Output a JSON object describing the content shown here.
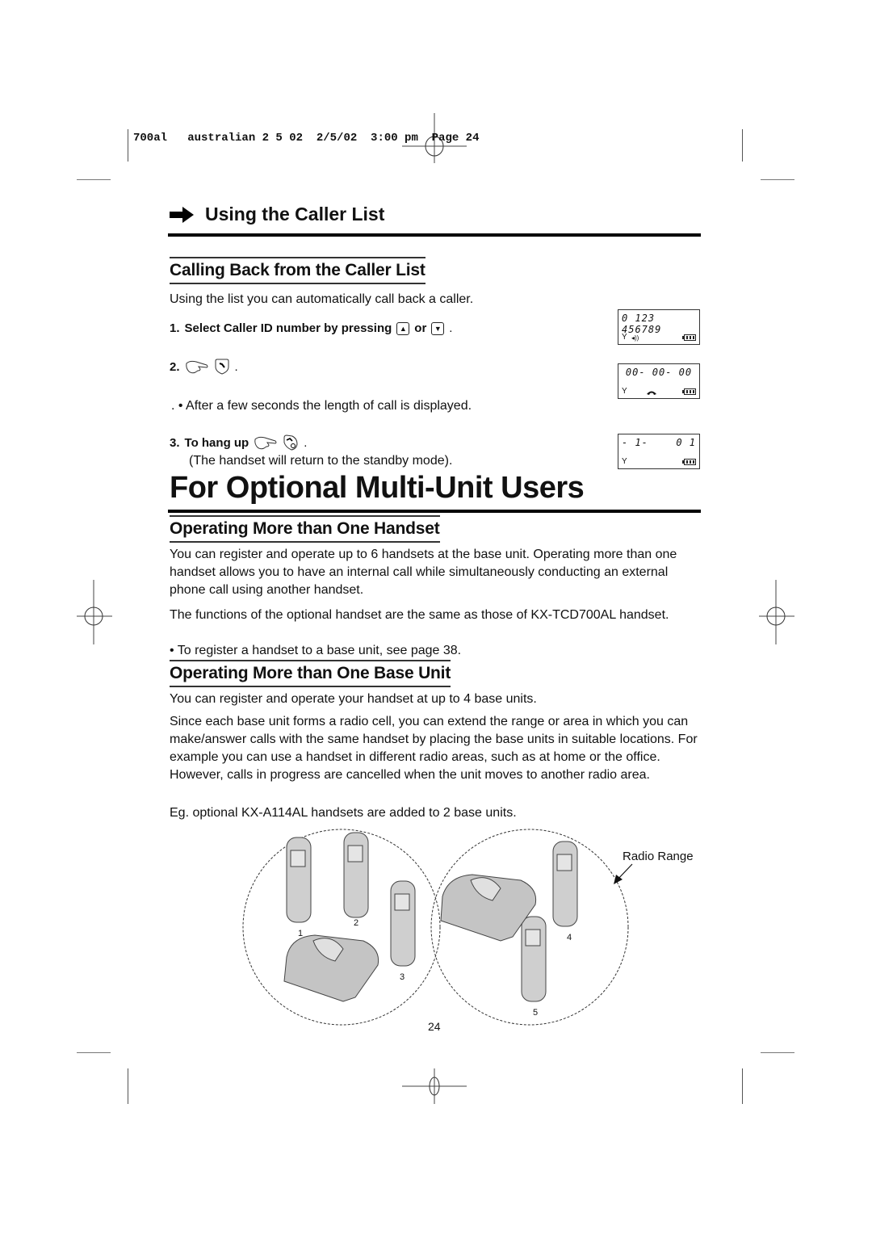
{
  "print_slug": "700al   australian 2 5 02  2/5/02  3:00 pm  Page 24",
  "section": {
    "arrow_icon": "right-arrow-icon",
    "title": "Using the Caller List"
  },
  "calling_back": {
    "heading": "Calling Back from the Caller List",
    "intro": "Using the list you can automatically call back a caller.",
    "steps": [
      {
        "num": "1.",
        "text": "Select Caller ID number by pressing",
        "keys": [
          "up-key",
          "down-key"
        ],
        "joiner": "or"
      },
      {
        "num": "2.",
        "text": "",
        "keys": [
          "press-hand",
          "talk-key"
        ]
      },
      {
        "num": "3.",
        "text": "To hang up",
        "keys": [
          "press-hand",
          "off-key"
        ]
      }
    ],
    "note_after_step2": ".   • After a few seconds the length of call is displayed.",
    "note_after_step3": "(The handset will return to the standby mode)."
  },
  "lcd_displays": [
    {
      "digits": "0 123 456789",
      "icons": [
        "antenna",
        "ringer",
        "battery"
      ]
    },
    {
      "digits": "00- 00- 00",
      "icons": [
        "antenna",
        "handset",
        "battery"
      ]
    },
    {
      "digits_left": "- 1-",
      "digits_right": "0 1",
      "icons": [
        "antenna",
        "battery"
      ]
    }
  ],
  "main_title": "For Optional Multi-Unit Users",
  "more_handsets": {
    "heading": "Operating More than One Handset",
    "para1": "You can register and operate up to 6 handsets at the base unit. Operating more than one handset allows you to have an internal call while simultaneously conducting an external phone call using another handset.",
    "para2": "The functions of the optional handset are the same as those of KX-TCD700AL handset.",
    "bullet": "• To register a handset to a base unit, see page 38."
  },
  "more_bases": {
    "heading": "Operating More than One Base Unit",
    "para1": "You can register and operate your handset at up to 4 base units.",
    "para2": "Since each base unit forms a radio cell, you can extend the range or area in which you can make/answer calls with the same handset by placing the base units in suitable locations. For example you can use a handset in different radio areas, such as at home or the office. However, calls in progress are cancelled when the unit moves to another radio area.",
    "para3": "Eg. optional KX-A114AL handsets are added to 2 base units."
  },
  "figure": {
    "radio_range_label": "Radio Range",
    "handset_labels": [
      "1",
      "2",
      "3",
      "4",
      "5"
    ]
  },
  "page_number": "24"
}
